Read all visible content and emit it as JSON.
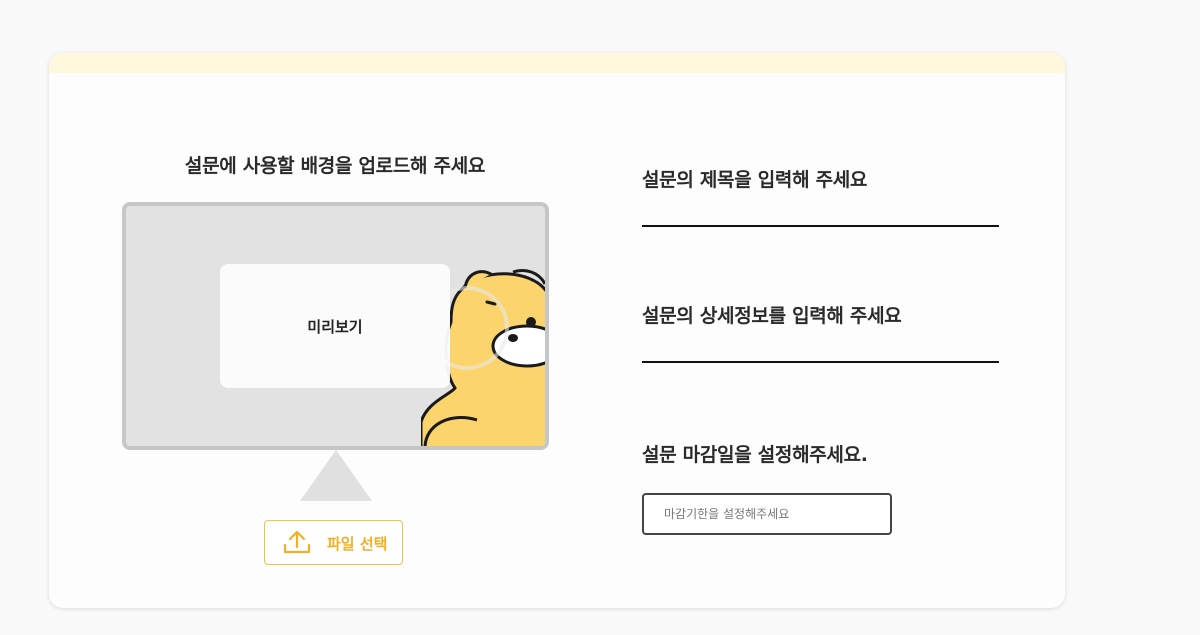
{
  "upload": {
    "title": "설문에 사용할 배경을 업로드해 주세요",
    "preview_label": "미리보기",
    "file_button_label": "파일 선택",
    "icon": "upload-icon"
  },
  "form": {
    "title_label": "설문의 제목을 입력해 주세요",
    "title_value": "",
    "detail_label": "설문의 상세정보를 입력해 주세요",
    "detail_value": "",
    "deadline_label": "설문 마감일을 설정해주세요.",
    "deadline_placeholder": "마감기한을 설정해주세요"
  },
  "colors": {
    "accent": "#f2b124",
    "topbar": "#fff8dc",
    "monitor_frame": "#c6c6c6",
    "monitor_screen": "#e2e2e2"
  }
}
